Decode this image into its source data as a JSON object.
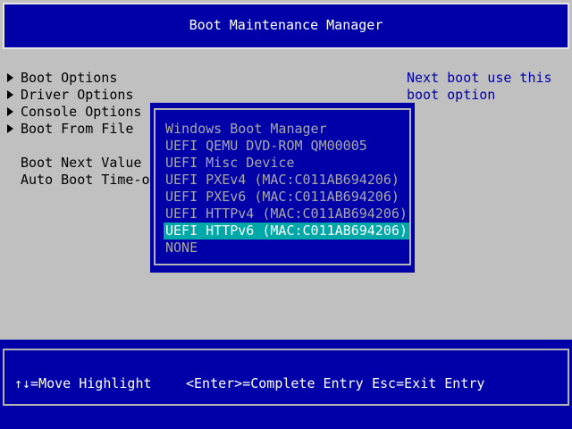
{
  "header": {
    "title": "Boot Maintenance Manager"
  },
  "menu": {
    "items": [
      {
        "label": "Boot Options"
      },
      {
        "label": "Driver Options"
      },
      {
        "label": "Console Options"
      },
      {
        "label": "Boot From File"
      }
    ],
    "boot_next_label": "Boot Next Value",
    "auto_boot_label": "Auto Boot Time-out"
  },
  "help": {
    "line1": "Next boot use this",
    "line2": "boot option"
  },
  "popup": {
    "options": [
      "Windows Boot Manager",
      "UEFI QEMU DVD-ROM QM00005",
      "UEFI Misc Device",
      "UEFI PXEv4 (MAC:C011AB694206)",
      "UEFI PXEv6 (MAC:C011AB694206)",
      "UEFI HTTPv4 (MAC:C011AB694206)",
      "UEFI HTTPv6 (MAC:C011AB694206)",
      "NONE"
    ],
    "selected": "UEFI HTTPv6 (MAC:C011AB694206)"
  },
  "footer": {
    "move_hint": "↑↓=Move Highlight",
    "enter_hint": "<Enter>=Complete Entry",
    "esc_hint": "Esc=Exit Entry"
  },
  "colors": {
    "background": "#c0c0c0",
    "primary_blue": "#0000a8",
    "highlight": "#00a8a8"
  }
}
